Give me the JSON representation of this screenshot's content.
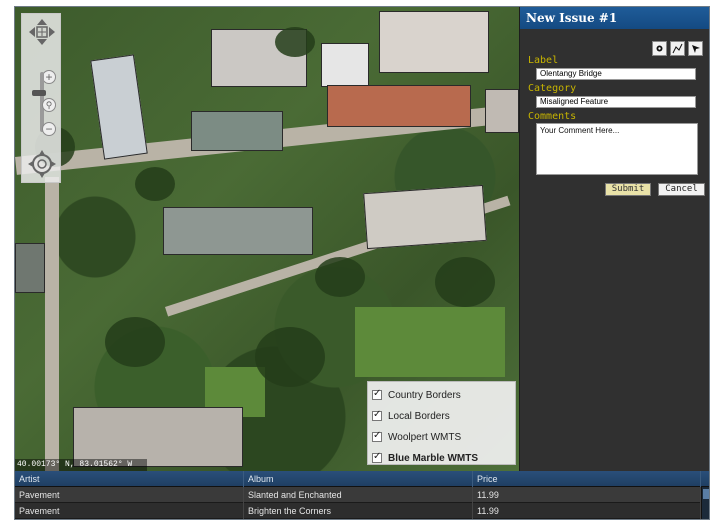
{
  "map": {
    "coordinates": "40.00173° N, 83.01562° W",
    "layers": [
      {
        "label": "Country Borders",
        "checked": true,
        "bold": false
      },
      {
        "label": "Local Borders",
        "checked": true,
        "bold": false
      },
      {
        "label": "Woolpert WMTS",
        "checked": true,
        "bold": false
      },
      {
        "label": "Blue Marble WMTS",
        "checked": true,
        "bold": true
      }
    ],
    "nav_icons": [
      "pan-arrows-icon",
      "zoom-in-icon",
      "zoom-box-icon",
      "zoom-out-icon",
      "rotate-icon"
    ]
  },
  "panel": {
    "title": "New Issue #1",
    "tools": [
      "point-tool-icon",
      "line-tool-icon",
      "select-pointer-icon"
    ],
    "fields": {
      "label_caption": "Label",
      "label_value": "Olentangy Bridge",
      "category_caption": "Category",
      "category_value": "Misaligned Feature",
      "comments_caption": "Comments",
      "comments_value": "Your Comment Here..."
    },
    "submit_label": "Submit",
    "cancel_label": "Cancel"
  },
  "grid": {
    "columns": [
      "Artist",
      "Album",
      "Price"
    ],
    "rows": [
      [
        "Pavement",
        "Slanted and Enchanted",
        "11.99"
      ],
      [
        "Pavement",
        "Brighten the Corners",
        "11.99"
      ]
    ]
  },
  "colors": {
    "panel_header": "#1f5c99",
    "field_caption": "#c7b400",
    "grid_header": "#2a4f7a"
  }
}
